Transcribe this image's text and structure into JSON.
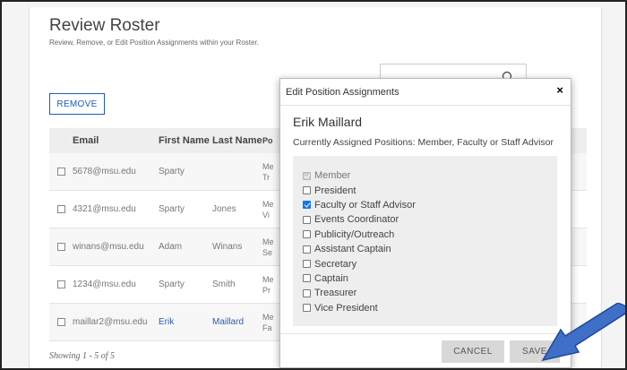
{
  "page": {
    "title": "Review Roster",
    "subtitle": "Review, Remove, or Edit Position Assignments within your Roster.",
    "remove_label": "REMOVE",
    "showing": "Showing 1 - 5 of 5"
  },
  "table": {
    "headers": [
      "Email",
      "First Name",
      "Last Name",
      "Po"
    ],
    "rows": [
      {
        "email": "5678@msu.edu",
        "first": "Sparty",
        "last": "",
        "pos": "Me\nTr"
      },
      {
        "email": "4321@msu.edu",
        "first": "Sparty",
        "last": "Jones",
        "pos": "Me\nVi"
      },
      {
        "email": "winans@msu.edu",
        "first": "Adam",
        "last": "Winans",
        "pos": "Me\nSe"
      },
      {
        "email": "1234@msu.edu",
        "first": "Sparty",
        "last": "Smith",
        "pos": "Me\nPr"
      },
      {
        "email": "maillar2@msu.edu",
        "first": "Erik",
        "last": "Maillard",
        "pos": "Me\nFa"
      }
    ]
  },
  "modal": {
    "title": "Edit Position Assignments",
    "close": "×",
    "name": "Erik Maillard",
    "assigned": "Currently Assigned Positions: Member, Faculty or Staff Advisor",
    "positions": [
      {
        "label": "Member",
        "state": "disabled"
      },
      {
        "label": "President",
        "state": "unchecked"
      },
      {
        "label": "Faculty or Staff Advisor",
        "state": "checked"
      },
      {
        "label": "Events Coordinator",
        "state": "unchecked"
      },
      {
        "label": "Publicity/Outreach",
        "state": "unchecked"
      },
      {
        "label": "Assistant Captain",
        "state": "unchecked"
      },
      {
        "label": "Secretary",
        "state": "unchecked"
      },
      {
        "label": "Captain",
        "state": "unchecked"
      },
      {
        "label": "Treasurer",
        "state": "unchecked"
      },
      {
        "label": "Vice President",
        "state": "unchecked"
      }
    ],
    "cancel_label": "CANCEL",
    "save_label": "SAVE"
  },
  "colors": {
    "link": "#2a5db0",
    "arrow": "#3f6fc6",
    "checkbox_checked": "#1a73e8"
  },
  "icons": {
    "search": "search-icon",
    "close": "close-icon",
    "arrow": "pointer-arrow-icon"
  }
}
